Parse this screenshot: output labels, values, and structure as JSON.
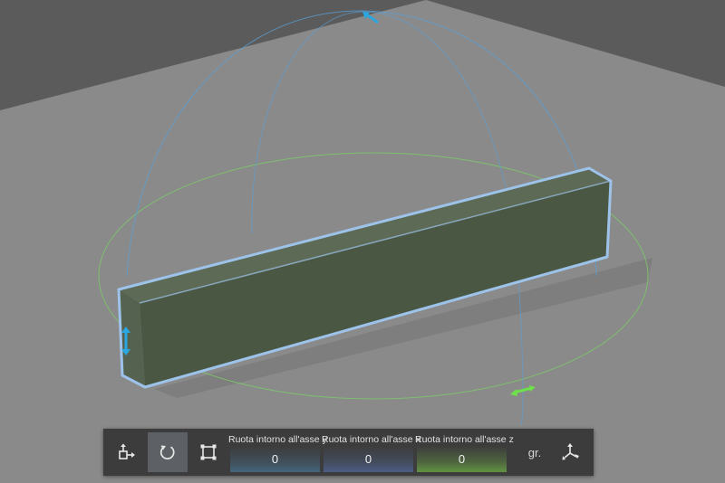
{
  "toolbar": {
    "tools": [
      {
        "name": "move-tool",
        "icon": "move-icon",
        "active": false
      },
      {
        "name": "rotate-tool",
        "icon": "rotate-icon",
        "active": true
      },
      {
        "name": "scale-tool",
        "icon": "scale-icon",
        "active": false
      }
    ],
    "axes": [
      {
        "label": "Ruota intorno all'asse y",
        "value": "0",
        "accent": "#4a86b0"
      },
      {
        "label": "Ruota intorno all'asse x",
        "value": "0",
        "accent": "#5c7dcc"
      },
      {
        "label": "Ruota intorno all'asse z",
        "value": "0",
        "accent": "#6fae45"
      }
    ],
    "unit_label": "gr.",
    "pivot_icon": "pivot-axes-icon"
  },
  "scene": {
    "object": "rectangular-block",
    "colors": {
      "ground": "#8a8a8a",
      "background": "#5b5b5b",
      "block_front": "#4a5843",
      "block_top": "#5d6b56",
      "selection_outline": "#9dc3ea",
      "gizmo_y": "#3aa0d8",
      "gizmo_z": "#76e05a"
    }
  }
}
